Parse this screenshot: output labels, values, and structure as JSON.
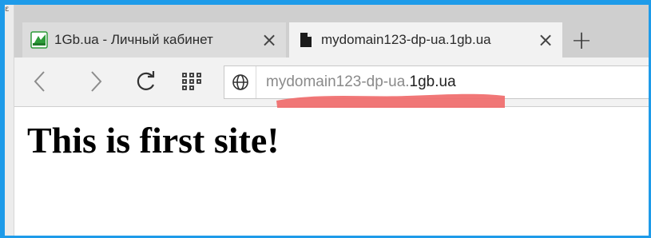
{
  "window": {
    "side_glyph": "ε"
  },
  "tabs": [
    {
      "title": "1Gb.ua - Личный кабинет",
      "favicon": "1gb-favicon",
      "active": false,
      "close_icon": "×"
    },
    {
      "title": "mydomain123-dp-ua.1gb.ua",
      "favicon": "document-icon",
      "active": true,
      "close_icon": "×"
    }
  ],
  "toolbar": {
    "new_tab_icon": "+",
    "back_icon": "‹",
    "forward_icon": "›",
    "reload_icon": "C",
    "address": {
      "subdomain": "mydomain123-dp-ua.",
      "domain": "1gb.ua"
    }
  },
  "page": {
    "heading": "This is first site!"
  },
  "colors": {
    "frame_border": "#1e9be9",
    "tabstrip_bg": "#cfcfcf",
    "toolbar_bg": "#f2f2f2",
    "scribble": "#f06b6b",
    "favicon_green": "#2e9b3a"
  }
}
